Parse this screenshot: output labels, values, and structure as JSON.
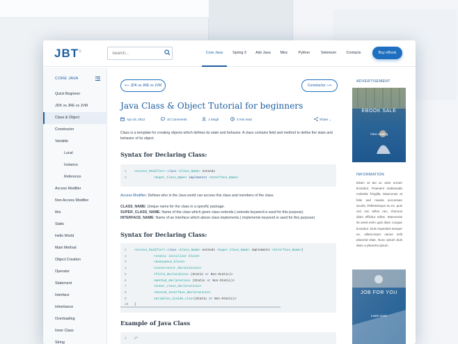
{
  "logo": "JBT",
  "logo_mark": "®",
  "search": {
    "placeholder": "Search..."
  },
  "nav": [
    "Core Java",
    "Spring 3",
    "Adv Java",
    "Misc",
    "Python",
    "Selenium",
    "Contacts"
  ],
  "ebook_button": "Buy eBook",
  "sidebar": {
    "heading": "CORE JAVA",
    "items": [
      {
        "label": "Quick Beginner"
      },
      {
        "label": "JDK vs JRE vs JVM"
      },
      {
        "label": "Class & Object",
        "active": true
      },
      {
        "label": "Constructor"
      },
      {
        "label": "Variable"
      },
      {
        "label": "Local",
        "sub": true
      },
      {
        "label": "Instance",
        "sub": true
      },
      {
        "label": "Reference",
        "sub": true
      },
      {
        "label": "Access Modifier"
      },
      {
        "label": "Non Access Modifier"
      },
      {
        "label": "this"
      },
      {
        "label": "Static"
      },
      {
        "label": "Hello World"
      },
      {
        "label": "Main Method"
      },
      {
        "label": "Object Creation"
      },
      {
        "label": "Operator"
      },
      {
        "label": "Statement"
      },
      {
        "label": "Interface"
      },
      {
        "label": "Inheritance"
      },
      {
        "label": "Overloading"
      },
      {
        "label": "Inner Class"
      },
      {
        "label": "String"
      }
    ]
  },
  "pager": {
    "prev": "JDK vs JRE vs JVM",
    "next": "Constructor"
  },
  "article": {
    "title": "Java Class & Object Tutorial for beginners",
    "date": "Apr 19, 2012",
    "comments": "32 Comments",
    "author": "J Singh",
    "read_time": "3 min read",
    "share": "Share",
    "intro": "Class is a template for creating objects which defines its state and behavior. A class contains field and method to define the state and behavior of its object.",
    "h_syntax1": "Syntax for Declaring Class:",
    "code1": [
      {
        "n": "1",
        "parts": [
          [
            "tag",
            "<Access_Modifier>"
          ],
          [
            "kw",
            " class "
          ],
          [
            "tag",
            "<Class_Name>"
          ],
          [
            "plain",
            " extends"
          ]
        ]
      },
      {
        "n": "2",
        "indent": true,
        "parts": [
          [
            "tag",
            "<Super_Class_Name>"
          ],
          [
            "kw",
            " implements "
          ],
          [
            "tag",
            "<Interface_Name>"
          ]
        ]
      }
    ],
    "access_label": "Access Modifier",
    "access_text": ": Defines who in the Java world can access this class and members of the class.",
    "defs": [
      {
        "term": "CLASS_NAME",
        "text": ": Unique name for the class in a specific package."
      },
      {
        "term": "SUPER_CLASS_NAME",
        "text": ": Name of the class which given class extends.( extends keyword is used for this purpose)"
      },
      {
        "term": "INTERFACE_NAME",
        "text": ": Name of an Interface which above class implements.( implements keyword is used for this purpose)"
      }
    ],
    "h_syntax2": "Syntax for Declaring Class:",
    "code2": [
      {
        "n": "1",
        "parts": [
          [
            "tag",
            "<Access_Modifier>"
          ],
          [
            "kw",
            " class "
          ],
          [
            "tag",
            "<Class_Name>"
          ],
          [
            "plain",
            " extends "
          ],
          [
            "tag",
            "<Super_Class_Name>"
          ],
          [
            "plain",
            " implements "
          ],
          [
            "tag",
            "<Interface_Name>"
          ],
          [
            "plain",
            "{"
          ]
        ]
      },
      {
        "n": "2",
        "indent": true,
        "parts": [
          [
            "tag",
            "<static initilizar block>"
          ]
        ]
      },
      {
        "n": "3",
        "indent": true,
        "parts": [
          [
            "tag",
            "<ananymous_block>"
          ]
        ]
      },
      {
        "n": "4",
        "indent": true,
        "parts": [
          [
            "tag",
            "<constructor_declarations>"
          ]
        ]
      },
      {
        "n": "5",
        "indent": true,
        "parts": [
          [
            "tag",
            "<field_declarations"
          ],
          [
            "plain",
            " (Static "
          ],
          [
            "kw",
            "or"
          ],
          [
            "plain",
            " Non-Static)>"
          ]
        ]
      },
      {
        "n": "6",
        "indent": true,
        "parts": [
          [
            "tag",
            "<method_declarations"
          ],
          [
            "plain",
            " (Static "
          ],
          [
            "kw",
            "or"
          ],
          [
            "plain",
            " Non-Static)>"
          ]
        ]
      },
      {
        "n": "7",
        "indent": true,
        "parts": [
          [
            "tag",
            "<inner_class_declarations>"
          ]
        ]
      },
      {
        "n": "8",
        "indent": true,
        "parts": [
          [
            "tag",
            "<nested_interface_declarations>"
          ]
        ]
      },
      {
        "n": "9",
        "indent": true,
        "parts": [
          [
            "tag",
            "variables_inside_class"
          ],
          [
            "plain",
            "(Static "
          ],
          [
            "kw",
            "or"
          ],
          [
            "plain",
            " Non-Static)>"
          ]
        ]
      },
      {
        "n": "10",
        "parts": [
          [
            "plain",
            "}"
          ]
        ]
      }
    ],
    "h_example": "Example of  Java Class",
    "code3": [
      {
        "n": "1",
        "parts": [
          [
            "plain",
            "/*"
          ]
        ]
      }
    ]
  },
  "right": {
    "advertisement": "ADVERTISEMENT",
    "promo1_title": "EBOOK SALE",
    "promo1_link": "View catalog",
    "info_title": "INFORMATION",
    "info_text": "Etiam at dui ac ante ornare tincidunt. Praesent malesuada molestie fringilla. Maecenas at felis sed massa accumsan iaculis. Pellentesque eu ex, quis orci nec tellus nec, rhoncus diam efficitur tellus. Maecenas sit amet enim quis diam congue tincidunt. Duis imperdiet semper ex, ullamcorper varius velit placerat vitae. Nunc ipsum duis diam a pharetra ipsum",
    "promo2_title": "JOB FOR YOU",
    "promo2_link": "Learn more"
  },
  "colors": {
    "primary": "#1e5fa0",
    "accent": "#1e6fbf",
    "code_tag": "#1aa09a"
  }
}
